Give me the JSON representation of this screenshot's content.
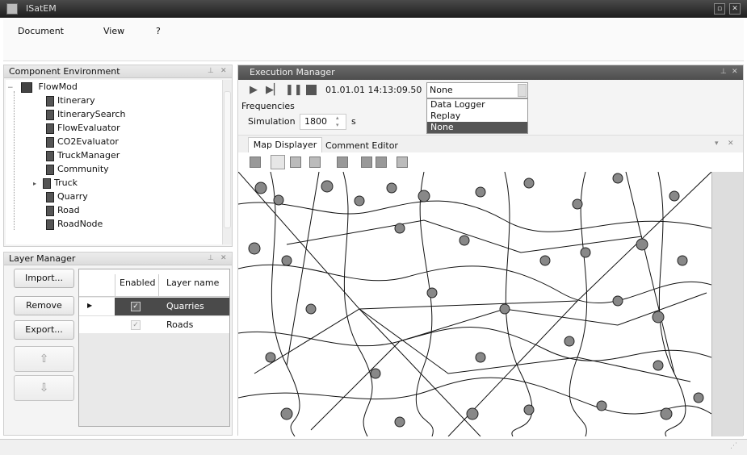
{
  "app": {
    "title": "ISatEM"
  },
  "menu": {
    "items": [
      "Document",
      "View",
      "?"
    ]
  },
  "component_env": {
    "title": "Component Environment",
    "root": "FlowMod",
    "items": [
      "Itinerary",
      "ItinerarySearch",
      "FlowEvaluator",
      "CO2Evaluator",
      "TruckManager",
      "Community",
      "Truck",
      "Quarry",
      "Road",
      "RoadNode"
    ]
  },
  "layer_manager": {
    "title": "Layer Manager",
    "buttons": {
      "import": "Import...",
      "remove": "Remove",
      "export": "Export..."
    },
    "columns": {
      "enabled": "Enabled",
      "name": "Layer name"
    },
    "rows": [
      {
        "name": "Quarries",
        "enabled": true,
        "selected": true
      },
      {
        "name": "Roads",
        "enabled": true,
        "selected": false
      }
    ]
  },
  "execution": {
    "title": "Execution Manager",
    "timestamp": "01.01.01 14:13:09.50",
    "mode_selected": "None",
    "mode_options": [
      "Data Logger",
      "Replay",
      "None"
    ],
    "frequencies_label": "Frequencies",
    "simulation_label": "Simulation",
    "simulation_value": "1800",
    "simulation_unit": "s"
  },
  "tabs": {
    "map": "Map Displayer",
    "comment": "Comment Editor"
  }
}
